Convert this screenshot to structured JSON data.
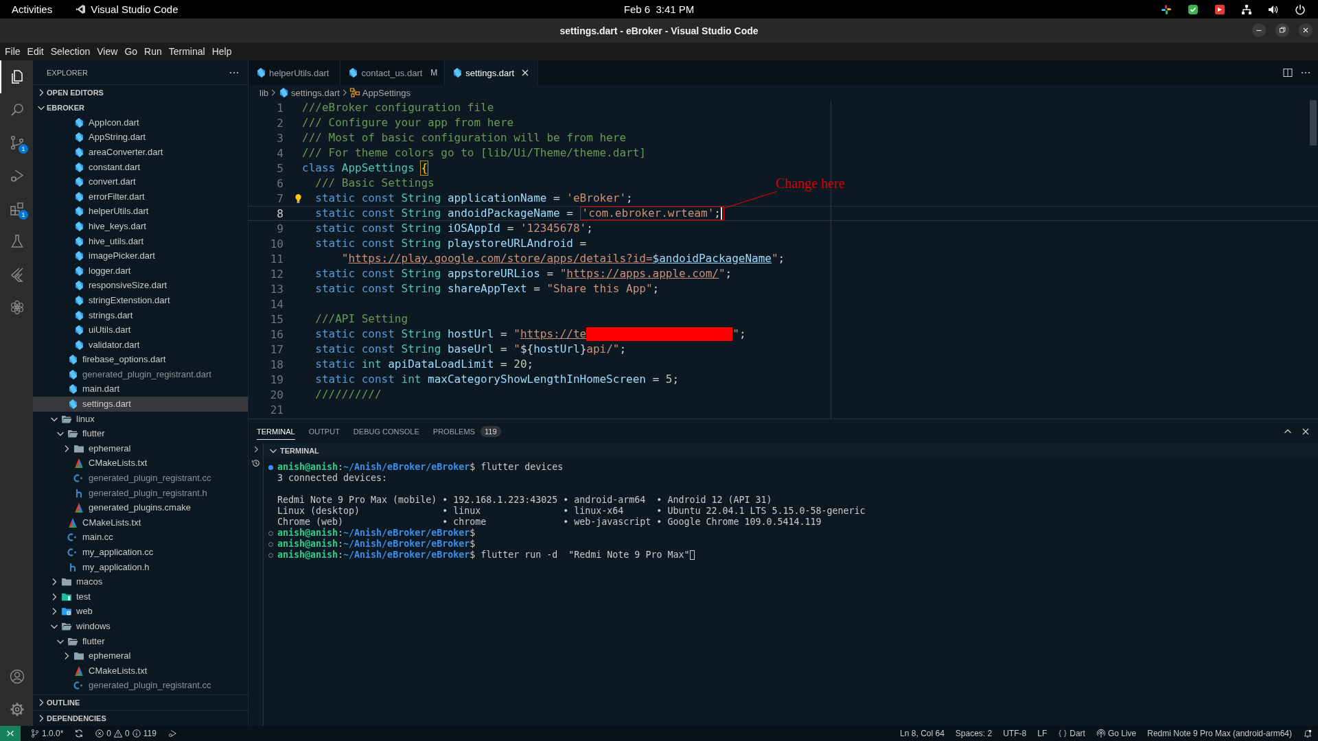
{
  "top_bar": {
    "activities": "Activities",
    "app_name": "Visual Studio Code",
    "date": "Feb 6",
    "time": "3:41 PM"
  },
  "window": {
    "title": "settings.dart - eBroker - Visual Studio Code"
  },
  "menu": [
    "File",
    "Edit",
    "Selection",
    "View",
    "Go",
    "Run",
    "Terminal",
    "Help"
  ],
  "activity_bar": {
    "items": [
      {
        "kind": "explorer",
        "selected": true
      },
      {
        "kind": "search",
        "selected": false
      },
      {
        "kind": "source-control",
        "selected": false,
        "badge": "1"
      },
      {
        "kind": "run",
        "selected": false
      },
      {
        "kind": "extensions",
        "selected": false,
        "badge": "1"
      },
      {
        "kind": "testing",
        "selected": false
      },
      {
        "kind": "flutter",
        "selected": false
      },
      {
        "kind": "knot",
        "selected": false
      }
    ],
    "bottom": [
      {
        "kind": "account"
      },
      {
        "kind": "settings"
      }
    ]
  },
  "sidebar": {
    "title": "EXPLORER",
    "sections": [
      {
        "label": "OPEN EDITORS",
        "expanded": false
      },
      {
        "label": "EBROKER",
        "expanded": true
      }
    ],
    "tree": [
      {
        "children": [
          {
            "children": [
              {
                "label": "AppIcon.dart",
                "kind": "dart",
                "selected": false,
                "ignored": false
              },
              {
                "label": "AppString.dart",
                "kind": "dart",
                "selected": false,
                "ignored": false
              },
              {
                "label": "areaConverter.dart",
                "kind": "dart",
                "selected": false,
                "ignored": false
              },
              {
                "label": "constant.dart",
                "kind": "dart",
                "selected": false,
                "ignored": false
              },
              {
                "label": "convert.dart",
                "kind": "dart",
                "selected": false,
                "ignored": false
              },
              {
                "label": "errorFilter.dart",
                "kind": "dart",
                "selected": false,
                "ignored": false
              },
              {
                "label": "helperUtils.dart",
                "kind": "dart",
                "selected": false,
                "ignored": false
              },
              {
                "label": "hive_keys.dart",
                "kind": "dart",
                "selected": false,
                "ignored": false
              },
              {
                "label": "hive_utils.dart",
                "kind": "dart",
                "selected": false,
                "ignored": false
              },
              {
                "label": "imagePicker.dart",
                "kind": "dart",
                "selected": false,
                "ignored": false
              },
              {
                "label": "logger.dart",
                "kind": "dart",
                "selected": false,
                "ignored": false
              },
              {
                "label": "responsiveSize.dart",
                "kind": "dart",
                "selected": false,
                "ignored": false
              },
              {
                "label": "stringExtenstion.dart",
                "kind": "dart",
                "selected": false,
                "ignored": false
              },
              {
                "label": "strings.dart",
                "kind": "dart",
                "selected": false,
                "ignored": false
              },
              {
                "label": "uiUtils.dart",
                "kind": "dart",
                "selected": false,
                "ignored": false
              },
              {
                "label": "validator.dart",
                "kind": "dart",
                "selected": false,
                "ignored": false
              }
            ]
          },
          {
            "label": "firebase_options.dart",
            "kind": "dart",
            "selected": false,
            "ignored": false
          },
          {
            "label": "generated_plugin_registrant.dart",
            "kind": "dart",
            "selected": false,
            "ignored": true
          },
          {
            "label": "main.dart",
            "kind": "dart",
            "selected": false,
            "ignored": false
          },
          {
            "label": "settings.dart",
            "kind": "dart",
            "selected": true,
            "ignored": false
          }
        ]
      },
      {
        "label": "linux",
        "kind": "folder",
        "expanded": true,
        "selected": false,
        "ignored": false,
        "children": [
          {
            "label": "flutter",
            "kind": "folder",
            "expanded": true,
            "selected": false,
            "ignored": false,
            "children": [
              {
                "label": "ephemeral",
                "kind": "folder",
                "expanded": false,
                "selected": false,
                "ignored": false
              },
              {
                "label": "CMakeLists.txt",
                "kind": "cmake",
                "selected": false,
                "ignored": false
              },
              {
                "label": "generated_plugin_registrant.cc",
                "kind": "cpp",
                "selected": false,
                "ignored": true
              },
              {
                "label": "generated_plugin_registrant.h",
                "kind": "header",
                "selected": false,
                "ignored": true
              },
              {
                "label": "generated_plugins.cmake",
                "kind": "cmake",
                "selected": false,
                "ignored": false
              }
            ]
          },
          {
            "label": "CMakeLists.txt",
            "kind": "cmake",
            "selected": false,
            "ignored": false
          },
          {
            "label": "main.cc",
            "kind": "cpp",
            "selected": false,
            "ignored": false
          },
          {
            "label": "my_application.cc",
            "kind": "cpp",
            "selected": false,
            "ignored": false
          },
          {
            "label": "my_application.h",
            "kind": "header",
            "selected": false,
            "ignored": false
          }
        ]
      },
      {
        "label": "macos",
        "kind": "folder",
        "expanded": false,
        "selected": false,
        "ignored": false
      },
      {
        "label": "test",
        "kind": "folder-test",
        "expanded": false,
        "selected": false,
        "ignored": false
      },
      {
        "label": "web",
        "kind": "folder-web",
        "expanded": false,
        "selected": false,
        "ignored": false
      },
      {
        "label": "windows",
        "kind": "folder",
        "expanded": true,
        "selected": false,
        "ignored": false,
        "children": [
          {
            "label": "flutter",
            "kind": "folder",
            "expanded": true,
            "selected": false,
            "ignored": false,
            "children": [
              {
                "label": "ephemeral",
                "kind": "folder",
                "expanded": false,
                "selected": false,
                "ignored": false
              },
              {
                "label": "CMakeLists.txt",
                "kind": "cmake",
                "selected": false,
                "ignored": false
              },
              {
                "label": "generated_plugin_registrant.cc",
                "kind": "cpp",
                "selected": false,
                "ignored": true
              }
            ]
          }
        ]
      }
    ],
    "bottom_sections": [
      {
        "label": "OUTLINE",
        "expanded": false
      },
      {
        "label": "DEPENDENCIES",
        "expanded": false
      }
    ]
  },
  "tabs": [
    {
      "label": "helperUtils.dart",
      "selected": false
    },
    {
      "label": "contact_us.dart",
      "selected": false,
      "status": "M"
    },
    {
      "label": "settings.dart",
      "selected": true
    }
  ],
  "breadcrumb": [
    {
      "kind": "folder",
      "label": "lib"
    },
    {
      "kind": "file",
      "label": "settings.dart"
    },
    {
      "kind": "class",
      "label": "AppSettings"
    }
  ],
  "editor": {
    "annotation": "Change here",
    "lines": [
      {
        "number": "1",
        "current": false,
        "lightbulb": false,
        "tokens": [
          {
            "kind": "comment",
            "text": "///eBroker configuration file"
          }
        ]
      },
      {
        "number": "2",
        "current": false,
        "lightbulb": false,
        "tokens": [
          {
            "kind": "comment",
            "text": "/// Configure your app from here"
          }
        ]
      },
      {
        "number": "3",
        "current": false,
        "lightbulb": false,
        "tokens": [
          {
            "kind": "comment",
            "text": "/// Most of basic configuration will be from here"
          }
        ]
      },
      {
        "number": "4",
        "current": false,
        "lightbulb": false,
        "tokens": [
          {
            "kind": "comment",
            "text": "/// For theme colors go to [lib/Ui/Theme/theme.dart]"
          }
        ]
      },
      {
        "number": "5",
        "current": false,
        "lightbulb": false,
        "tokens": [
          {
            "kind": "keyword",
            "text": "class "
          },
          {
            "kind": "type",
            "text": "AppSettings "
          },
          {
            "kind": "bracket",
            "text": "{"
          }
        ]
      },
      {
        "number": "6",
        "current": false,
        "lightbulb": false,
        "tokens": [
          {
            "kind": "comment",
            "text": "  /// Basic Settings"
          }
        ]
      },
      {
        "number": "7",
        "current": false,
        "lightbulb": true,
        "tokens": [
          {
            "kind": "keyword",
            "text": "  static const "
          },
          {
            "kind": "type",
            "text": "String "
          },
          {
            "kind": "var",
            "text": "applicationName"
          },
          {
            "kind": "punct",
            "text": " = "
          },
          {
            "kind": "string",
            "text": "'eBroker'"
          },
          {
            "kind": "punct",
            "text": ";"
          }
        ]
      },
      {
        "number": "8",
        "current": true,
        "lightbulb": false,
        "tokens": [
          {
            "kind": "keyword",
            "text": "  static const "
          },
          {
            "kind": "type",
            "text": "String "
          },
          {
            "kind": "var",
            "text": "andoidPackageName"
          },
          {
            "kind": "punct",
            "text": " = "
          },
          {
            "kind": "string",
            "text": "'com.ebroker.wrteam'",
            "boxed": true
          },
          {
            "kind": "punct",
            "text": ";",
            "boxed": true
          }
        ]
      },
      {
        "number": "9",
        "current": false,
        "lightbulb": false,
        "tokens": [
          {
            "kind": "keyword",
            "text": "  static const "
          },
          {
            "kind": "type",
            "text": "String "
          },
          {
            "kind": "var",
            "text": "iOSAppId"
          },
          {
            "kind": "punct",
            "text": " = "
          },
          {
            "kind": "string",
            "text": "'12345678'"
          },
          {
            "kind": "punct",
            "text": ";"
          }
        ]
      },
      {
        "number": "10",
        "current": false,
        "lightbulb": false,
        "tokens": [
          {
            "kind": "keyword",
            "text": "  static const "
          },
          {
            "kind": "type",
            "text": "String "
          },
          {
            "kind": "var",
            "text": "playstoreURLAndroid"
          },
          {
            "kind": "punct",
            "text": " ="
          }
        ]
      },
      {
        "number": "11",
        "current": false,
        "lightbulb": false,
        "tokens": [
          {
            "kind": "string",
            "text": "      \""
          },
          {
            "kind": "link",
            "text": "https://play.google.com/store/apps/details?id="
          },
          {
            "kind": "linkvar",
            "text": "$andoidPackageName"
          },
          {
            "kind": "string",
            "text": "\""
          },
          {
            "kind": "punct",
            "text": ";"
          }
        ]
      },
      {
        "number": "12",
        "current": false,
        "lightbulb": false,
        "tokens": [
          {
            "kind": "keyword",
            "text": "  static const "
          },
          {
            "kind": "type",
            "text": "String "
          },
          {
            "kind": "var",
            "text": "appstoreURLios"
          },
          {
            "kind": "punct",
            "text": " = "
          },
          {
            "kind": "string",
            "text": "\""
          },
          {
            "kind": "link",
            "text": "https://apps.apple.com/"
          },
          {
            "kind": "string",
            "text": "\""
          },
          {
            "kind": "punct",
            "text": ";"
          }
        ]
      },
      {
        "number": "13",
        "current": false,
        "lightbulb": false,
        "tokens": [
          {
            "kind": "keyword",
            "text": "  static const "
          },
          {
            "kind": "type",
            "text": "String "
          },
          {
            "kind": "var",
            "text": "shareAppText"
          },
          {
            "kind": "punct",
            "text": " = "
          },
          {
            "kind": "string",
            "text": "\"Share this App\""
          },
          {
            "kind": "punct",
            "text": ";"
          }
        ]
      },
      {
        "number": "14",
        "current": false,
        "lightbulb": false
      },
      {
        "number": "15",
        "current": false,
        "lightbulb": false,
        "tokens": [
          {
            "kind": "comment",
            "text": "  ///API Setting"
          }
        ]
      },
      {
        "number": "16",
        "current": false,
        "lightbulb": false,
        "tokens": [
          {
            "kind": "keyword",
            "text": "  static const "
          },
          {
            "kind": "type",
            "text": "String "
          },
          {
            "kind": "var",
            "text": "hostUrl"
          },
          {
            "kind": "punct",
            "text": " = "
          },
          {
            "kind": "string",
            "text": "\""
          },
          {
            "kind": "link",
            "text": "https://te"
          },
          {
            "kind": "redacted"
          },
          {
            "kind": "string",
            "text": "\""
          },
          {
            "kind": "punct",
            "text": ";"
          }
        ]
      },
      {
        "number": "17",
        "current": false,
        "lightbulb": false,
        "tokens": [
          {
            "kind": "keyword",
            "text": "  static const "
          },
          {
            "kind": "type",
            "text": "String "
          },
          {
            "kind": "var",
            "text": "baseUrl"
          },
          {
            "kind": "punct",
            "text": " = "
          },
          {
            "kind": "string",
            "text": "\""
          },
          {
            "kind": "punct",
            "text": "${"
          },
          {
            "kind": "var",
            "text": "hostUrl"
          },
          {
            "kind": "punct",
            "text": "}"
          },
          {
            "kind": "string",
            "text": "api/\""
          },
          {
            "kind": "punct",
            "text": ";"
          }
        ]
      },
      {
        "number": "18",
        "current": false,
        "lightbulb": false,
        "tokens": [
          {
            "kind": "keyword",
            "text": "  static "
          },
          {
            "kind": "type",
            "text": "int "
          },
          {
            "kind": "var",
            "text": "apiDataLoadLimit"
          },
          {
            "kind": "punct",
            "text": " = "
          },
          {
            "kind": "number",
            "text": "20"
          },
          {
            "kind": "punct",
            "text": ";"
          }
        ]
      },
      {
        "number": "19",
        "current": false,
        "lightbulb": false,
        "tokens": [
          {
            "kind": "keyword",
            "text": "  static const "
          },
          {
            "kind": "type",
            "text": "int "
          },
          {
            "kind": "var",
            "text": "maxCategoryShowLengthInHomeScreen"
          },
          {
            "kind": "punct",
            "text": " = "
          },
          {
            "kind": "number",
            "text": "5"
          },
          {
            "kind": "punct",
            "text": ";"
          }
        ]
      },
      {
        "number": "20",
        "current": false,
        "lightbulb": false,
        "tokens": [
          {
            "kind": "comment",
            "text": "  //////////"
          }
        ]
      },
      {
        "number": "21",
        "current": false,
        "lightbulb": false
      }
    ]
  },
  "panel": {
    "tabs": [
      {
        "label": "TERMINAL",
        "selected": true
      },
      {
        "label": "OUTPUT",
        "selected": false
      },
      {
        "label": "DEBUG CONSOLE",
        "selected": false
      },
      {
        "label": "PROBLEMS",
        "selected": false,
        "count": "119"
      }
    ],
    "terminal": {
      "title": "TERMINAL",
      "lines": [
        {
          "kind": "prompt",
          "completed": true,
          "cursor": false,
          "segments": [
            {
              "kind": "user",
              "text": "anish@anish"
            },
            {
              "kind": "plain",
              "text": ":"
            },
            {
              "kind": "path",
              "text": "~/Anish/eBroker/eBroker"
            },
            {
              "kind": "plain",
              "text": "$ flutter devices"
            }
          ]
        },
        {
          "kind": "output",
          "segments": [
            {
              "kind": "plain",
              "text": "3 connected devices:"
            }
          ]
        },
        {
          "kind": "blank"
        },
        {
          "kind": "output",
          "segments": [
            {
              "kind": "plain",
              "text": "Redmi Note 9 Pro Max (mobile) • 192.168.1.223:43025 • android-arm64  • Android 12 (API 31)"
            }
          ]
        },
        {
          "kind": "output",
          "segments": [
            {
              "kind": "plain",
              "text": "Linux (desktop)               • linux               • linux-x64      • Ubuntu 22.04.1 LTS 5.15.0-58-generic"
            }
          ]
        },
        {
          "kind": "output",
          "segments": [
            {
              "kind": "plain",
              "text": "Chrome (web)                  • chrome              • web-javascript • Google Chrome 109.0.5414.119"
            }
          ]
        },
        {
          "kind": "prompt",
          "completed": false,
          "cursor": false,
          "segments": [
            {
              "kind": "user",
              "text": "anish@anish"
            },
            {
              "kind": "plain",
              "text": ":"
            },
            {
              "kind": "path",
              "text": "~/Anish/eBroker/eBroker"
            },
            {
              "kind": "plain",
              "text": "$"
            }
          ]
        },
        {
          "kind": "prompt",
          "completed": false,
          "cursor": false,
          "segments": [
            {
              "kind": "user",
              "text": "anish@anish"
            },
            {
              "kind": "plain",
              "text": ":"
            },
            {
              "kind": "path",
              "text": "~/Anish/eBroker/eBroker"
            },
            {
              "kind": "plain",
              "text": "$"
            }
          ]
        },
        {
          "kind": "prompt",
          "completed": false,
          "cursor": true,
          "segments": [
            {
              "kind": "user",
              "text": "anish@anish"
            },
            {
              "kind": "plain",
              "text": ":"
            },
            {
              "kind": "path",
              "text": "~/Anish/eBroker/eBroker"
            },
            {
              "kind": "plain",
              "text": "$ flutter run -d  \"Redmi Note 9 Pro Max\""
            }
          ]
        }
      ]
    }
  },
  "status_bar": {
    "branch": "1.0.0*",
    "errors": "0",
    "warnings": "0",
    "infos": "119",
    "right": [
      {
        "kind": "text",
        "text": "Ln 8, Col 64"
      },
      {
        "kind": "text",
        "text": "Spaces: 2"
      },
      {
        "kind": "text",
        "text": "UTF-8"
      },
      {
        "kind": "text",
        "text": "LF"
      },
      {
        "kind": "language",
        "text": "Dart"
      },
      {
        "kind": "live",
        "text": "Go Live"
      },
      {
        "kind": "text",
        "text": "Redmi Note 9 Pro Max (android-arm64)"
      },
      {
        "kind": "bell"
      }
    ]
  }
}
